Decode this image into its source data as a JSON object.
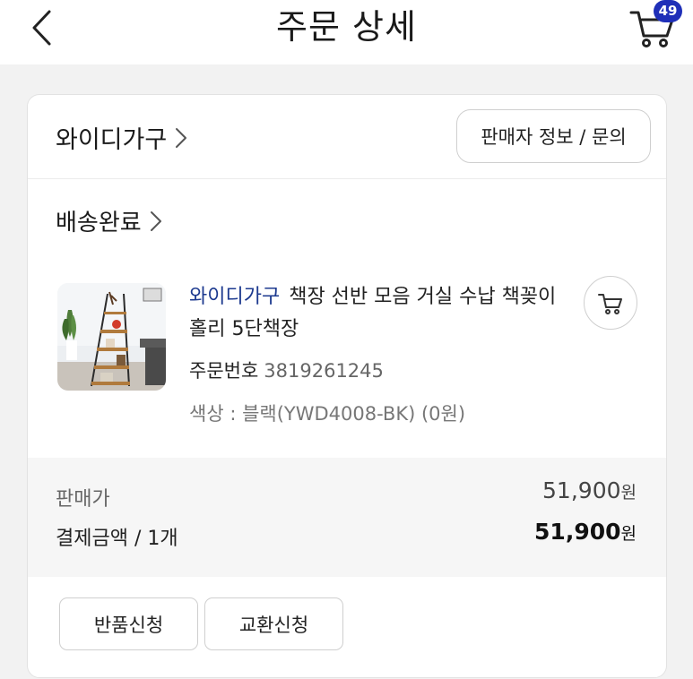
{
  "header": {
    "title": "주문 상세",
    "cart_count": "49",
    "back_icon": "chevron-left-icon",
    "cart_icon": "cart-icon"
  },
  "seller": {
    "name": "와이디가구",
    "info_button": "판매자 정보 / 문의"
  },
  "status": {
    "label": "배송완료"
  },
  "product": {
    "brand": "와이디가구",
    "title": "책장 선반 모음 거실 수납 책꽂이 홀리 5단책장",
    "order_label": "주문번호",
    "order_number": "3819261245",
    "option": "색상 : 블랙(YWD4008-BK) (0원)",
    "add_cart_icon": "cart-icon"
  },
  "price": {
    "sale_label": "판매가",
    "sale_value": "51,900",
    "currency": "원",
    "payment_label": "결제금액 / 1개",
    "payment_value": "51,900"
  },
  "actions": {
    "return": "반품신청",
    "exchange": "교환신청"
  },
  "colors": {
    "brand_blue": "#1d3a8f",
    "badge": "#1f2fb8"
  }
}
